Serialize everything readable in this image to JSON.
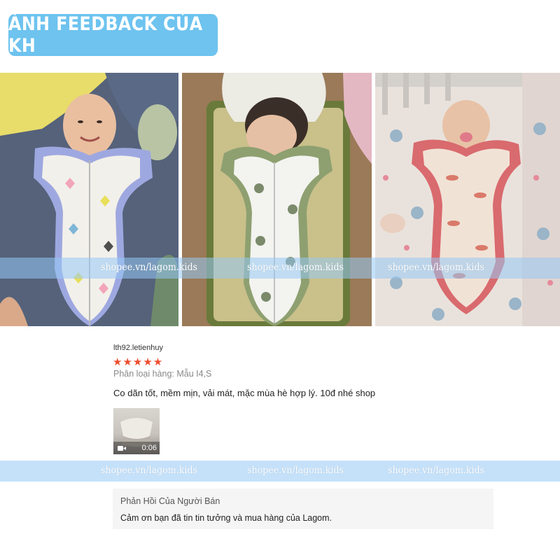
{
  "header": {
    "title": "ẢNH FEEDBACK CỦA KH",
    "badge_color": "#6ec3ef"
  },
  "photos": [
    {
      "subject": "baby smiling in kite-print swaddle sleep sack, lilac trim"
    },
    {
      "subject": "sleeping baby in green-trim swaddle on straw mat"
    },
    {
      "subject": "baby with pacifier in pink-trim fish-print swaddle in crib"
    }
  ],
  "watermark": {
    "text": "shopee.vn/lagom.kids"
  },
  "review": {
    "username": "lth92.letienhuy",
    "stars": "★★★★★",
    "rating": 5,
    "star_color": "#ee4d2d",
    "variant": "Phân loại hàng: Mẫu I4,S",
    "comment": "Co dãn tốt, mềm mịn, vải mát, mặc mùa hè hợp lý. 10đ nhé shop",
    "video": {
      "duration": "0:06",
      "icon": "video-camera-icon"
    }
  },
  "seller_reply": {
    "title": "Phản Hồi Của Người Bán",
    "text": "Cảm ơn bạn đã tin tin tưởng và mua hàng của Lagom."
  }
}
